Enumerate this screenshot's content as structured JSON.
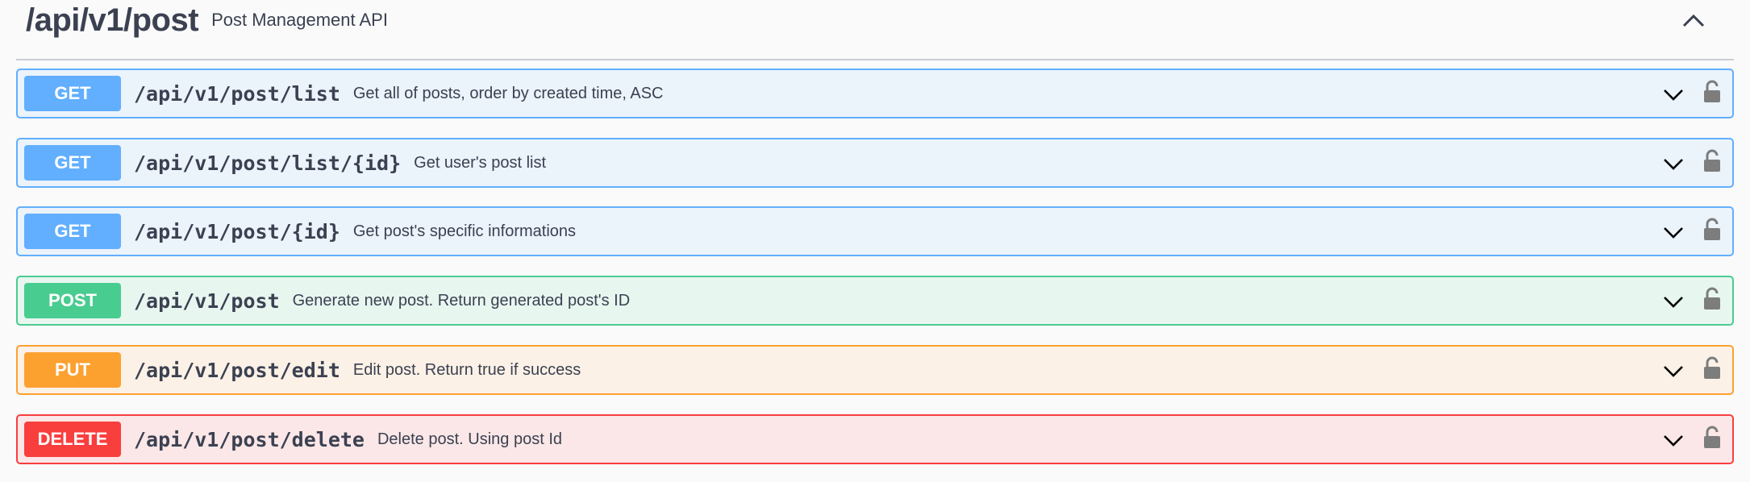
{
  "tag": {
    "title": "/api/v1/post",
    "description": "Post Management API",
    "toggle_icon": "chevron-up-icon"
  },
  "colors": {
    "get": "#61affe",
    "post": "#49cc90",
    "put": "#fca130",
    "delete": "#f93e3e"
  },
  "operations": [
    {
      "method": "GET",
      "path": "/api/v1/post/list",
      "summary": "Get all of posts, order by created time, ASC",
      "expand_icon": "chevron-down-icon",
      "auth_icon": "lock-icon"
    },
    {
      "method": "GET",
      "path": "/api/v1/post/list/{id}",
      "summary": "Get user's post list",
      "expand_icon": "chevron-down-icon",
      "auth_icon": "lock-icon"
    },
    {
      "method": "GET",
      "path": "/api/v1/post/{id}",
      "summary": "Get post's specific informations",
      "expand_icon": "chevron-down-icon",
      "auth_icon": "lock-icon"
    },
    {
      "method": "POST",
      "path": "/api/v1/post",
      "summary": "Generate new post. Return generated post's ID",
      "expand_icon": "chevron-down-icon",
      "auth_icon": "lock-icon"
    },
    {
      "method": "PUT",
      "path": "/api/v1/post/edit",
      "summary": "Edit post. Return true if success",
      "expand_icon": "chevron-down-icon",
      "auth_icon": "lock-icon"
    },
    {
      "method": "DELETE",
      "path": "/api/v1/post/delete",
      "summary": "Delete post. Using post Id",
      "expand_icon": "chevron-down-icon",
      "auth_icon": "lock-icon"
    }
  ]
}
